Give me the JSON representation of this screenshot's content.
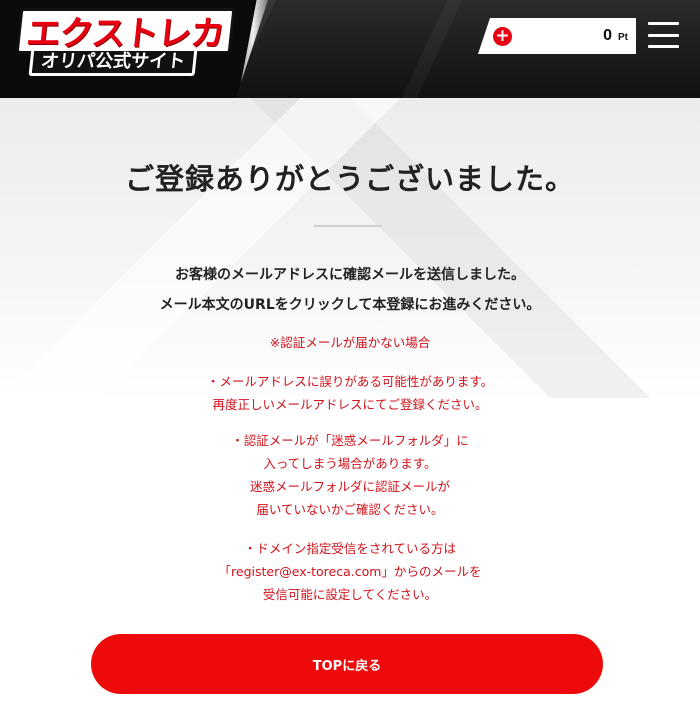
{
  "header": {
    "logo_top": "エクストレカ",
    "logo_bottom": "オリパ公式サイト",
    "points": {
      "value": "0",
      "unit": "Pt"
    }
  },
  "main": {
    "title": "ご登録ありがとうございました。",
    "message_line1": "お客様のメールアドレスに確認メールを送信しました。",
    "message_line2": "メール本文のURLをクリックして本登録にお進みください。",
    "note_heading": "※認証メールが届かない場合",
    "note1_line1": "・メールアドレスに誤りがある可能性があります。",
    "note1_line2": "再度正しいメールアドレスにてご登録ください。",
    "note2_line1": "・認証メールが「迷惑メールフォルダ」に",
    "note2_line2": "入ってしまう場合があります。",
    "note2_line3": "迷惑メールフォルダに認証メールが",
    "note2_line4": "届いていないかご確認ください。",
    "note3_line1": "・ドメイン指定受信をされている方は",
    "note3_line2": "「register@ex-toreca.com」からのメールを",
    "note3_line3": "受信可能に設定してください。",
    "top_button_label": "TOPに戻る"
  },
  "colors": {
    "accent": "#e60012",
    "note_text": "#d0121b",
    "header_bg": "#111111"
  },
  "icons": [
    "plus-icon",
    "menu-icon"
  ]
}
